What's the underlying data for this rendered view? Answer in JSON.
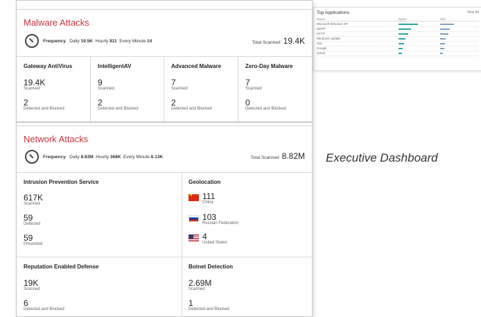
{
  "background_dashboard": {
    "top_applications": {
      "title": "Top Applications",
      "view_all": "View All",
      "columns": [
        "Name",
        "Bytes",
        "Hits"
      ],
      "rows": [
        "Microsoft Windows XP",
        "SMTP",
        "HTTP",
        "Windows Update",
        "SSL",
        "Google",
        "Gmail"
      ]
    }
  },
  "caption": "Executive Dashboard",
  "malware": {
    "title": "Malware Attacks",
    "frequency_label": "Frequency",
    "daily_label": "Daily",
    "daily_value": "19.5K",
    "hourly_label": "Hourly",
    "hourly_value": "811",
    "minute_label": "Every Minute",
    "minute_value": "14",
    "total_label": "Total Scanned",
    "total_value": "19.4K",
    "cards": [
      {
        "title": "Gateway AntiVirus",
        "scanned": "19.4K",
        "scanned_label": "Scanned",
        "blocked": "2",
        "blocked_label": "Detected and Blocked"
      },
      {
        "title": "IntelligentAV",
        "scanned": "9",
        "scanned_label": "Scanned",
        "blocked": "2",
        "blocked_label": "Detected and Blocked"
      },
      {
        "title": "Advanced Malware",
        "scanned": "7",
        "scanned_label": "Scanned",
        "blocked": "2",
        "blocked_label": "Detected and Blocked"
      },
      {
        "title": "Zero-Day Malware",
        "scanned": "7",
        "scanned_label": "Scanned",
        "blocked": "0",
        "blocked_label": "Detected and Blocked"
      }
    ]
  },
  "network": {
    "title": "Network Attacks",
    "frequency_label": "Frequency",
    "daily_label": "Daily",
    "daily_value": "8.83M",
    "hourly_label": "Hourly",
    "hourly_value": "368K",
    "minute_label": "Every Minute",
    "minute_value": "6.13K",
    "total_label": "Total Scanned",
    "total_value": "8.82M",
    "ips": {
      "title": "Intrusion Prevention Service",
      "scanned": "617K",
      "scanned_label": "Scanned",
      "detected": "59",
      "detected_label": "Detected",
      "prevented": "59",
      "prevented_label": "Prevented"
    },
    "geolocation": {
      "title": "Geolocation",
      "items": [
        {
          "count": "111",
          "country": "China",
          "flag_icon": "china-flag-icon"
        },
        {
          "count": "103",
          "country": "Russian Federation",
          "flag_icon": "russia-flag-icon"
        },
        {
          "count": "4",
          "country": "United States",
          "flag_icon": "us-flag-icon"
        }
      ]
    },
    "red": {
      "title": "Reputation Enabled Defense",
      "scanned": "19K",
      "scanned_label": "Scanned",
      "blocked": "6",
      "blocked_label": "Detected and Blocked"
    },
    "botnet": {
      "title": "Botnet Detection",
      "scanned": "2.69M",
      "scanned_label": "Scanned",
      "blocked": "1",
      "blocked_label": "Detected and Blocked"
    }
  },
  "colors": {
    "accent": "#c8323c",
    "border": "#d8d8d8"
  }
}
